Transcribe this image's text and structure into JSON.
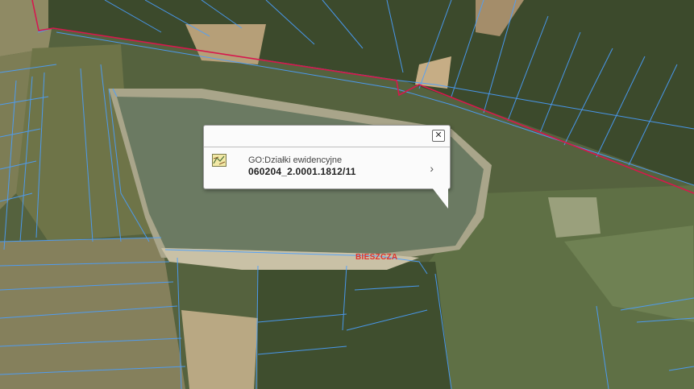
{
  "map": {
    "place_label": "BIESZCZA"
  },
  "popup": {
    "close_symbol": "✕",
    "layer_icon": "parcel-map-icon",
    "layer_name": "GO:Działki ewidencyjne",
    "parcel_id": "060204_2.0001.1812/11",
    "more_symbol": "›"
  },
  "colors": {
    "parcel_lines": "#4a9fff",
    "boundary_line": "#d8174c",
    "water": "#6b7a62",
    "popup_bg": "#fbfbfb"
  }
}
